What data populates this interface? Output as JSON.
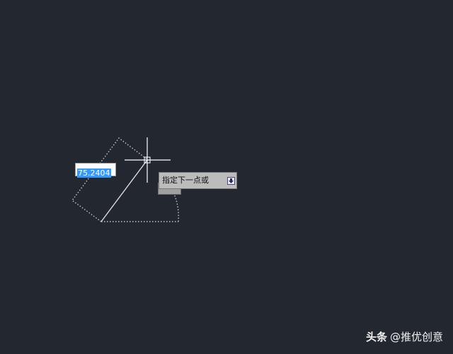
{
  "canvas": {
    "background": "#232830",
    "colors": {
      "preview_line": "#e6e6e6",
      "dotted_outline": "#c8c8c8",
      "crosshair": "#ffffff"
    }
  },
  "dynamic_input": {
    "value": "75.2404"
  },
  "command_prompt": {
    "text": "指定下一点或",
    "options_icon": "down-arrow-icon"
  },
  "watermark": {
    "brand": "头条",
    "handle": "@推优创意"
  }
}
